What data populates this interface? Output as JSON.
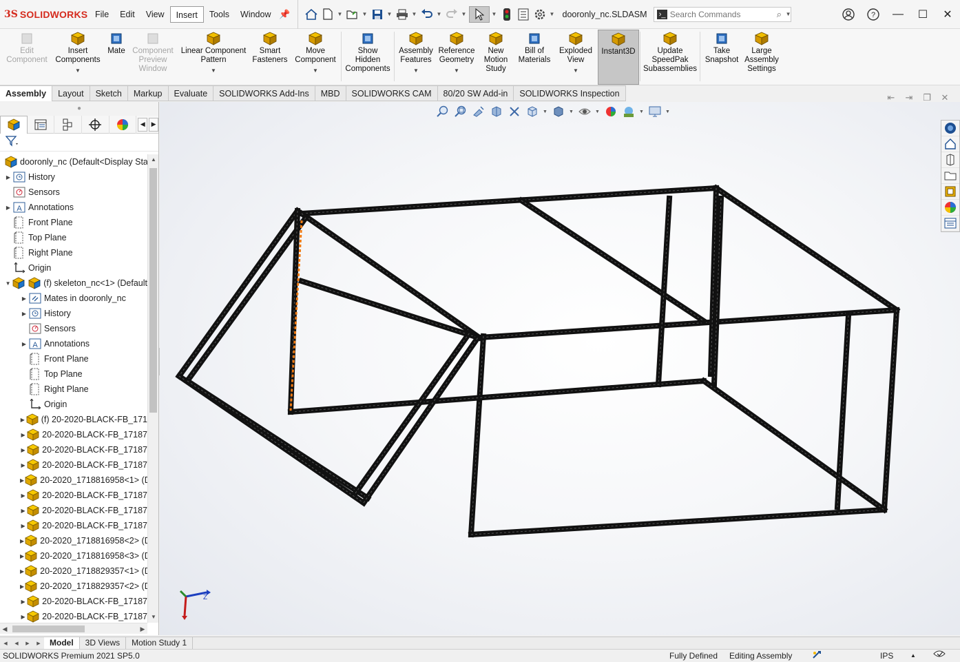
{
  "app": {
    "logo_ds": "3S",
    "logo_text": "SOLIDWORKS",
    "document_title": "dooronly_nc.SLDASM"
  },
  "menu": [
    "File",
    "Edit",
    "View",
    "Insert",
    "Tools",
    "Window"
  ],
  "search": {
    "placeholder": "Search Commands"
  },
  "commands": [
    {
      "label1": "Edit",
      "label2": "Component",
      "label3": "",
      "disabled": true,
      "dropdown": false,
      "icon": "edit-component-icon"
    },
    {
      "label1": "Insert",
      "label2": "Components",
      "label3": "",
      "disabled": false,
      "dropdown": true,
      "icon": "insert-components-icon"
    },
    {
      "label1": "Mate",
      "label2": "",
      "label3": "",
      "disabled": false,
      "dropdown": false,
      "icon": "mate-icon"
    },
    {
      "label1": "Component",
      "label2": "Preview",
      "label3": "Window",
      "disabled": true,
      "dropdown": false,
      "icon": "component-preview-icon"
    },
    {
      "label1": "Linear Component",
      "label2": "Pattern",
      "label3": "",
      "disabled": false,
      "dropdown": true,
      "icon": "linear-pattern-icon"
    },
    {
      "label1": "Smart",
      "label2": "Fasteners",
      "label3": "",
      "disabled": false,
      "dropdown": false,
      "icon": "smart-fasteners-icon"
    },
    {
      "label1": "Move",
      "label2": "Component",
      "label3": "",
      "disabled": false,
      "dropdown": true,
      "icon": "move-component-icon"
    },
    {
      "label1": "Show",
      "label2": "Hidden",
      "label3": "Components",
      "disabled": false,
      "dropdown": false,
      "icon": "show-hidden-icon"
    },
    {
      "label1": "Assembly",
      "label2": "Features",
      "label3": "",
      "disabled": false,
      "dropdown": true,
      "icon": "assembly-features-icon"
    },
    {
      "label1": "Reference",
      "label2": "Geometry",
      "label3": "",
      "disabled": false,
      "dropdown": true,
      "icon": "reference-geometry-icon"
    },
    {
      "label1": "New",
      "label2": "Motion",
      "label3": "Study",
      "disabled": false,
      "dropdown": false,
      "icon": "motion-study-icon"
    },
    {
      "label1": "Bill of",
      "label2": "Materials",
      "label3": "",
      "disabled": false,
      "dropdown": false,
      "icon": "bom-icon"
    },
    {
      "label1": "Exploded",
      "label2": "View",
      "label3": "",
      "disabled": false,
      "dropdown": true,
      "icon": "exploded-view-icon"
    },
    {
      "label1": "Instant3D",
      "label2": "",
      "label3": "",
      "disabled": false,
      "dropdown": false,
      "icon": "instant3d-icon"
    },
    {
      "label1": "Update",
      "label2": "SpeedPak",
      "label3": "Subassemblies",
      "disabled": false,
      "dropdown": false,
      "icon": "speedpak-icon"
    },
    {
      "label1": "Take",
      "label2": "Snapshot",
      "label3": "",
      "disabled": false,
      "dropdown": false,
      "icon": "snapshot-icon"
    },
    {
      "label1": "Large",
      "label2": "Assembly",
      "label3": "Settings",
      "disabled": false,
      "dropdown": false,
      "icon": "large-assembly-icon"
    }
  ],
  "tabs": [
    "Assembly",
    "Layout",
    "Sketch",
    "Markup",
    "Evaluate",
    "SOLIDWORKS Add-Ins",
    "MBD",
    "SOLIDWORKS CAM",
    "80/20 SW Add-in",
    "SOLIDWORKS Inspection"
  ],
  "tree": [
    {
      "label": "dooronly_nc  (Default<Display Stat",
      "icon": "assembly-icon",
      "expand": "",
      "level": 0
    },
    {
      "label": "History",
      "icon": "history-icon",
      "expand": "▶",
      "level": 0
    },
    {
      "label": "Sensors",
      "icon": "sensor-icon",
      "expand": "",
      "level": 0
    },
    {
      "label": "Annotations",
      "icon": "annotations-icon",
      "expand": "▶",
      "level": 0
    },
    {
      "label": "Front Plane",
      "icon": "plane-icon",
      "expand": "",
      "level": 0
    },
    {
      "label": "Top Plane",
      "icon": "plane-icon",
      "expand": "",
      "level": 0
    },
    {
      "label": "Right Plane",
      "icon": "plane-icon",
      "expand": "",
      "level": 0
    },
    {
      "label": "Origin",
      "icon": "origin-icon",
      "expand": "",
      "level": 0
    },
    {
      "label": "(f) skeleton_nc<1> (Default",
      "icon": "subassembly-icon",
      "expand": "▼",
      "level": 0
    },
    {
      "label": "Mates in dooronly_nc",
      "icon": "mates-icon",
      "expand": "▶",
      "level": 1
    },
    {
      "label": "History",
      "icon": "history-icon",
      "expand": "▶",
      "level": 1
    },
    {
      "label": "Sensors",
      "icon": "sensor-icon",
      "expand": "",
      "level": 1
    },
    {
      "label": "Annotations",
      "icon": "annotations-icon",
      "expand": "▶",
      "level": 1
    },
    {
      "label": "Front Plane",
      "icon": "plane-icon",
      "expand": "",
      "level": 1
    },
    {
      "label": "Top Plane",
      "icon": "plane-icon",
      "expand": "",
      "level": 1
    },
    {
      "label": "Right Plane",
      "icon": "plane-icon",
      "expand": "",
      "level": 1
    },
    {
      "label": "Origin",
      "icon": "origin-icon",
      "expand": "",
      "level": 1
    },
    {
      "label": "(f) 20-2020-BLACK-FB_171",
      "icon": "part-icon",
      "expand": "▶",
      "level": 1
    },
    {
      "label": "20-2020-BLACK-FB_17187",
      "icon": "part-icon",
      "expand": "▶",
      "level": 1
    },
    {
      "label": "20-2020-BLACK-FB_17187",
      "icon": "part-icon",
      "expand": "▶",
      "level": 1
    },
    {
      "label": "20-2020-BLACK-FB_17187",
      "icon": "part-icon",
      "expand": "▶",
      "level": 1
    },
    {
      "label": "20-2020_1718816958<1> (D",
      "icon": "part-icon",
      "expand": "▶",
      "level": 1
    },
    {
      "label": "20-2020-BLACK-FB_17187",
      "icon": "part-icon",
      "expand": "▶",
      "level": 1
    },
    {
      "label": "20-2020-BLACK-FB_17187",
      "icon": "part-icon",
      "expand": "▶",
      "level": 1
    },
    {
      "label": "20-2020-BLACK-FB_17187",
      "icon": "part-icon",
      "expand": "▶",
      "level": 1
    },
    {
      "label": "20-2020_1718816958<2> (D",
      "icon": "part-icon",
      "expand": "▶",
      "level": 1
    },
    {
      "label": "20-2020_1718816958<3> (D",
      "icon": "part-icon",
      "expand": "▶",
      "level": 1
    },
    {
      "label": "20-2020_1718829357<1> (D",
      "icon": "part-icon",
      "expand": "▶",
      "level": 1
    },
    {
      "label": "20-2020_1718829357<2> (D",
      "icon": "part-icon",
      "expand": "▶",
      "level": 1
    },
    {
      "label": "20-2020-BLACK-FB_17187",
      "icon": "part-icon",
      "expand": "▶",
      "level": 1
    },
    {
      "label": "20-2020-BLACK-FB_17187",
      "icon": "part-icon",
      "expand": "▶",
      "level": 1
    }
  ],
  "bottom_tabs": [
    "Model",
    "3D Views",
    "Motion Study 1"
  ],
  "status": {
    "product": "SOLIDWORKS Premium 2021 SP5.0",
    "defined": "Fully Defined",
    "mode": "Editing Assembly",
    "units": "IPS",
    "units_arrow": "▲"
  },
  "triad": {
    "z": "Z"
  },
  "colors": {
    "brand": "#d52b1e",
    "accent": "#1d4f91",
    "part": "#f2b800",
    "frame": "#111111",
    "highlight": "#f07a12"
  }
}
